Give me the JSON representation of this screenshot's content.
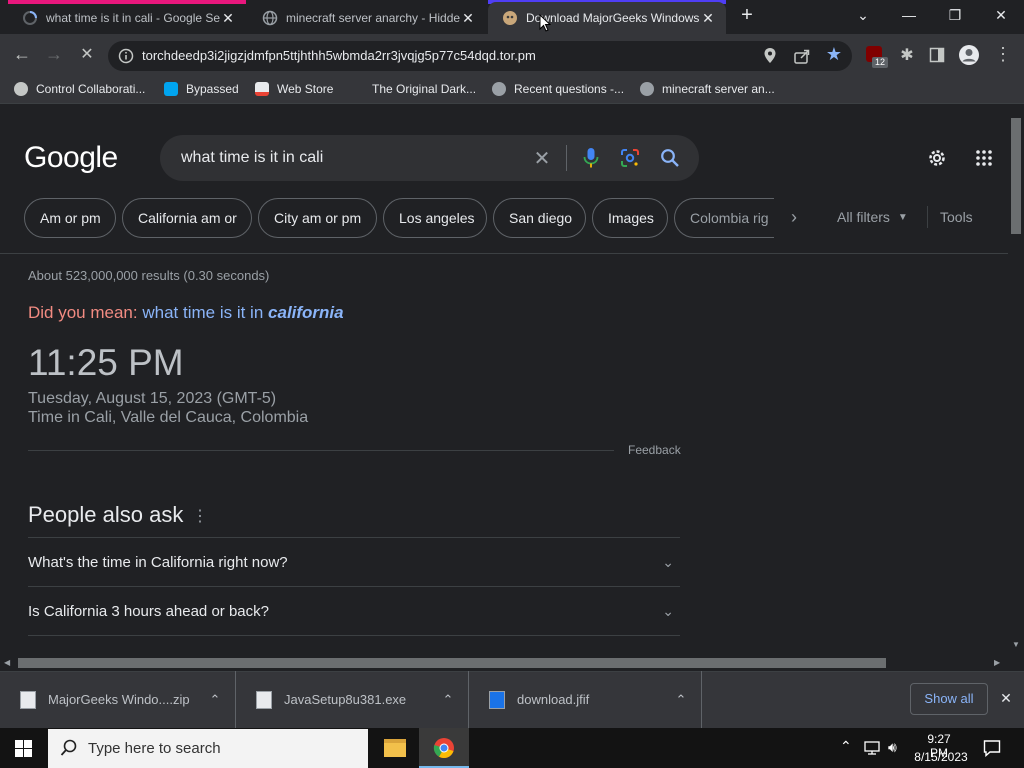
{
  "tabs": [
    {
      "title": "what time is it in cali - Google Se",
      "active": false
    },
    {
      "title": "minecraft server anarchy - Hidde",
      "active": false
    },
    {
      "title": "Download MajorGeeks Windows",
      "active": true
    }
  ],
  "toolbar": {
    "url": "torchdeedp3i2jigzjdmfpn5ttjhthh5wbmda2rr3jvqjg5p77c54dqd.tor.pm",
    "extension_badge": "12"
  },
  "bookmarks": [
    "Control Collaborati...",
    "Bypassed",
    "Web Store",
    "The Original Dark...",
    "Recent questions -...",
    "minecraft server an..."
  ],
  "google": {
    "logo": "Google",
    "query": "what time is it in cali",
    "chips": [
      "Am or pm",
      "California am or",
      "City am or pm",
      "Los angeles",
      "San diego",
      "Images",
      "Colombia rig"
    ],
    "all_filters": "All filters",
    "tools": "Tools",
    "results_stats": "About 523,000,000 results (0.30 seconds)",
    "did_you_mean_label": "Did you mean:",
    "did_you_mean_plain": "what time is it in",
    "did_you_mean_bold": "california",
    "time": "11:25 PM",
    "date": "Tuesday, August 15, 2023 (GMT-5)",
    "location": "Time in Cali, Valle del Cauca, Colombia",
    "feedback": "Feedback",
    "paa_title": "People also ask",
    "paa": [
      "What's the time in California right now?",
      "Is California 3 hours ahead or back?"
    ]
  },
  "downloads": {
    "items": [
      "MajorGeeks Windo....zip",
      "JavaSetup8u381.exe",
      "download.jfif"
    ],
    "show_all": "Show all"
  },
  "taskbar": {
    "search_placeholder": "Type here to search",
    "clock_time": "9:27 PM",
    "clock_date": "8/15/2023"
  },
  "colors": {
    "accent_blue": "#8ab4f8",
    "did_you_mean_red": "#f28b82",
    "star_blue": "#8ab4f8"
  }
}
